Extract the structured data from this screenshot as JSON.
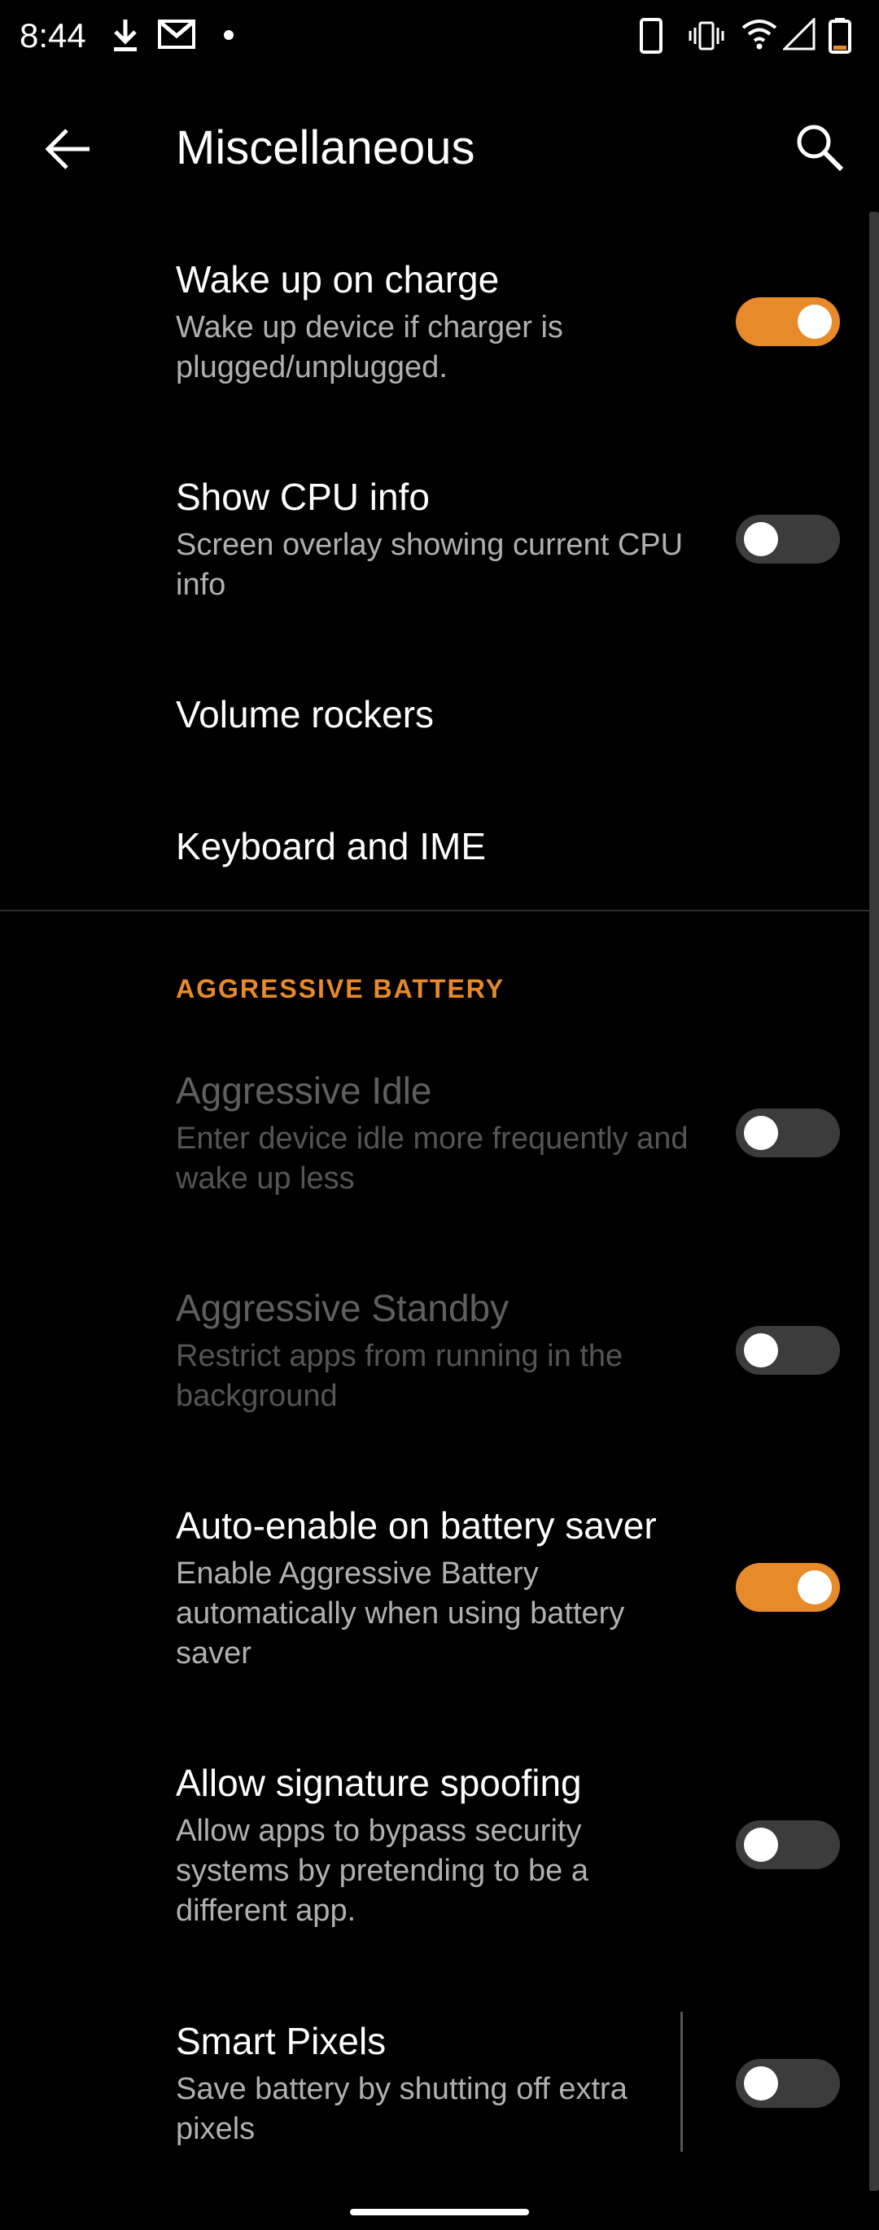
{
  "status_bar": {
    "time": "8:44",
    "left_icons": [
      "download-icon",
      "gmail-icon",
      "dot-icon"
    ],
    "right_icons": [
      "phone-outline-icon",
      "vibrate-icon",
      "wifi-icon",
      "signal-icon",
      "battery-icon"
    ]
  },
  "app_bar": {
    "title": "Miscellaneous",
    "back_icon": "arrow-left-icon",
    "search_icon": "search-icon"
  },
  "items": [
    {
      "title": "Wake up on charge",
      "subtitle": "Wake up device if charger is plugged/unplugged.",
      "toggle": "on",
      "enabled": true
    },
    {
      "title": "Show CPU info",
      "subtitle": "Screen overlay showing current CPU info",
      "toggle": "off",
      "enabled": true
    },
    {
      "title": "Volume rockers"
    },
    {
      "title": "Keyboard and IME"
    }
  ],
  "section": {
    "header": "AGGRESSIVE BATTERY",
    "items": [
      {
        "title": "Aggressive Idle",
        "subtitle": "Enter device idle more frequently and wake up less",
        "toggle": "off",
        "enabled": false
      },
      {
        "title": "Aggressive Standby",
        "subtitle": "Restrict apps from running in the background",
        "toggle": "off",
        "enabled": false
      },
      {
        "title": "Auto-enable on battery saver",
        "subtitle": "Enable Aggressive Battery automatically when using battery saver",
        "toggle": "on",
        "enabled": true
      },
      {
        "title": "Allow signature spoofing",
        "subtitle": "Allow apps to bypass security systems by pretending to be a different app.",
        "toggle": "off",
        "enabled": true
      },
      {
        "title": "Smart Pixels",
        "subtitle": "Save battery by shutting off extra pixels",
        "toggle": "off",
        "enabled": true
      }
    ]
  },
  "colors": {
    "accent": "#e68a2a",
    "background": "#000000",
    "toggle_off": "#3c3c3c"
  }
}
